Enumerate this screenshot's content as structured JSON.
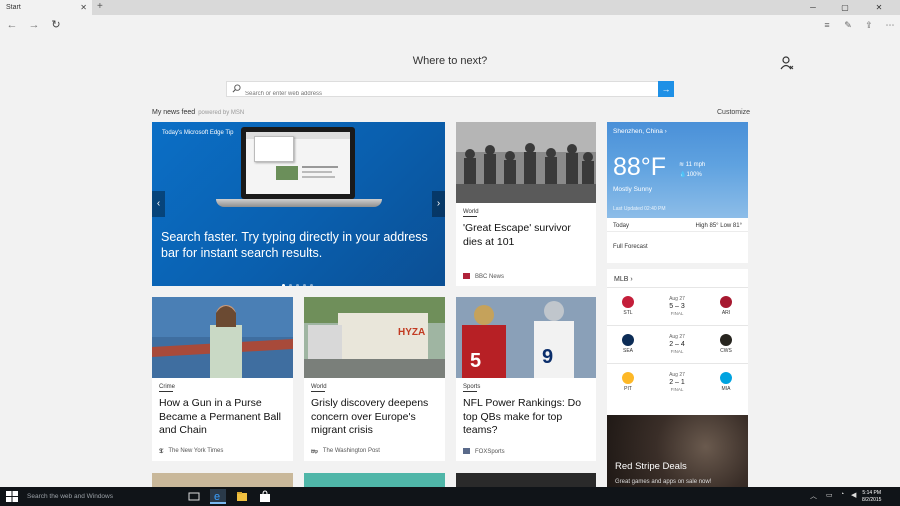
{
  "tab": {
    "title": "Start",
    "close": "✕",
    "new": "+"
  },
  "window": {
    "minimize": "─",
    "maximize": "▢",
    "close": "✕"
  },
  "nav": {
    "back": "←",
    "forward": "→",
    "refresh": "↻"
  },
  "tools": {
    "hub": "≡",
    "note": "✎",
    "share": "⇪",
    "more": "⋯"
  },
  "page": {
    "where_to_next": "Where to next?",
    "search_placeholder": "Search or enter web address",
    "go": "→",
    "feed_title": "My news feed",
    "powered_by": "powered by MSN",
    "customize": "Customize"
  },
  "hero": {
    "tip_title": "Today's Microsoft Edge Tip",
    "caption": "Search faster. Try typing directly in your address bar for instant search results.",
    "prev": "‹",
    "next": "›",
    "dot_count": 5,
    "active_dot": 1
  },
  "news": [
    {
      "category": "World",
      "headline": "'Great Escape' survivor dies at 101",
      "source": "BBC News"
    },
    {
      "category": "Crime",
      "headline": "How a Gun in a Purse Became a Permanent Ball and Chain",
      "source": "The New York Times"
    },
    {
      "category": "World",
      "headline": "Grisly discovery deepens concern over Europe's migrant crisis",
      "source": "The Washington Post"
    },
    {
      "category": "Sports",
      "headline": "NFL Power Rankings: Do top QBs make for top teams?",
      "source": "FOXSports"
    }
  ],
  "weather": {
    "city": "Shenzhen, China ›",
    "temp": "88°F",
    "condition": "Mostly Sunny",
    "wind": "11 mph",
    "humidity": "100%",
    "updated": "Last Updated 02:40 PM",
    "today": "Today",
    "high_low": "High 85°  Low 81°",
    "full_forecast": "Full Forecast"
  },
  "mlb": {
    "title": "MLB ›",
    "games": [
      {
        "date": "Aug 27",
        "score": "5 – 3",
        "status": "FINAL",
        "home": "STL",
        "away": "ARI",
        "home_color": "#c41e3a",
        "away_color": "#a71930"
      },
      {
        "date": "Aug 27",
        "score": "2 – 4",
        "status": "FINAL",
        "home": "SEA",
        "away": "CWS",
        "home_color": "#0c2c56",
        "away_color": "#27251f"
      },
      {
        "date": "Aug 27",
        "score": "2 – 1",
        "status": "FINAL",
        "home": "PIT",
        "away": "MIA",
        "home_color": "#fdb827",
        "away_color": "#00a3e0"
      }
    ]
  },
  "ad": {
    "title": "Red Stripe Deals",
    "subtitle": "Great games and apps on sale now!"
  },
  "taskbar": {
    "search": "Search the web and Windows",
    "tray_up": "︿",
    "time": "5:14 PM",
    "date": "8/2/2015"
  }
}
